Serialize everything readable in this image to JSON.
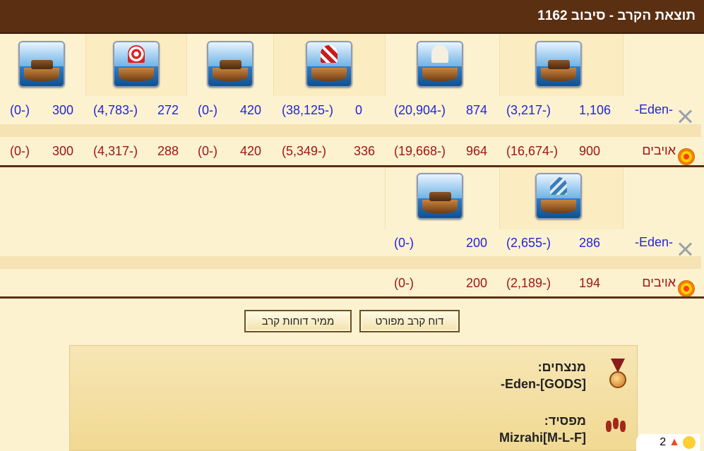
{
  "header": {
    "title": "תוצאת הקרב - סיבוב 1162"
  },
  "rows": {
    "eden_label": "-Eden-",
    "enemy_label": "אויבים"
  },
  "group1": {
    "eden": [
      {
        "value": "1,106",
        "loss": "(3,217-)"
      },
      {
        "value": "874",
        "loss": "(20,904-)"
      },
      {
        "value": "0",
        "loss": "(38,125-)"
      },
      {
        "value": "420",
        "loss": "(0-)"
      },
      {
        "value": "272",
        "loss": "(4,783-)"
      },
      {
        "value": "300",
        "loss": "(0-)"
      }
    ],
    "enemy": [
      {
        "value": "900",
        "loss": "(16,674-)"
      },
      {
        "value": "964",
        "loss": "(19,668-)"
      },
      {
        "value": "336",
        "loss": "(5,349-)"
      },
      {
        "value": "420",
        "loss": "(0-)"
      },
      {
        "value": "288",
        "loss": "(4,317-)"
      },
      {
        "value": "300",
        "loss": "(0-)"
      }
    ]
  },
  "group2": {
    "eden": [
      {
        "value": "286",
        "loss": "(2,655-)"
      },
      {
        "value": "200",
        "loss": "(0-)"
      }
    ],
    "enemy": [
      {
        "value": "194",
        "loss": "(2,189-)"
      },
      {
        "value": "200",
        "loss": "(0-)"
      }
    ]
  },
  "buttons": {
    "detailed_report": "דוח קרב מפורט",
    "report_converter": "ממיר דוחות קרב"
  },
  "result": {
    "winners_label": "מנצחים:",
    "winners_name": "Eden-[GODS]-",
    "loser_label": "מפסיד:",
    "loser_name": "Mizrahi[M-L-F]"
  },
  "corner": {
    "count": "2"
  },
  "colors": {
    "header_bg": "#5a2f12",
    "eden_text": "#2424d8",
    "enemy_text": "#a01515",
    "panel_bg": "#fdf2d0"
  }
}
